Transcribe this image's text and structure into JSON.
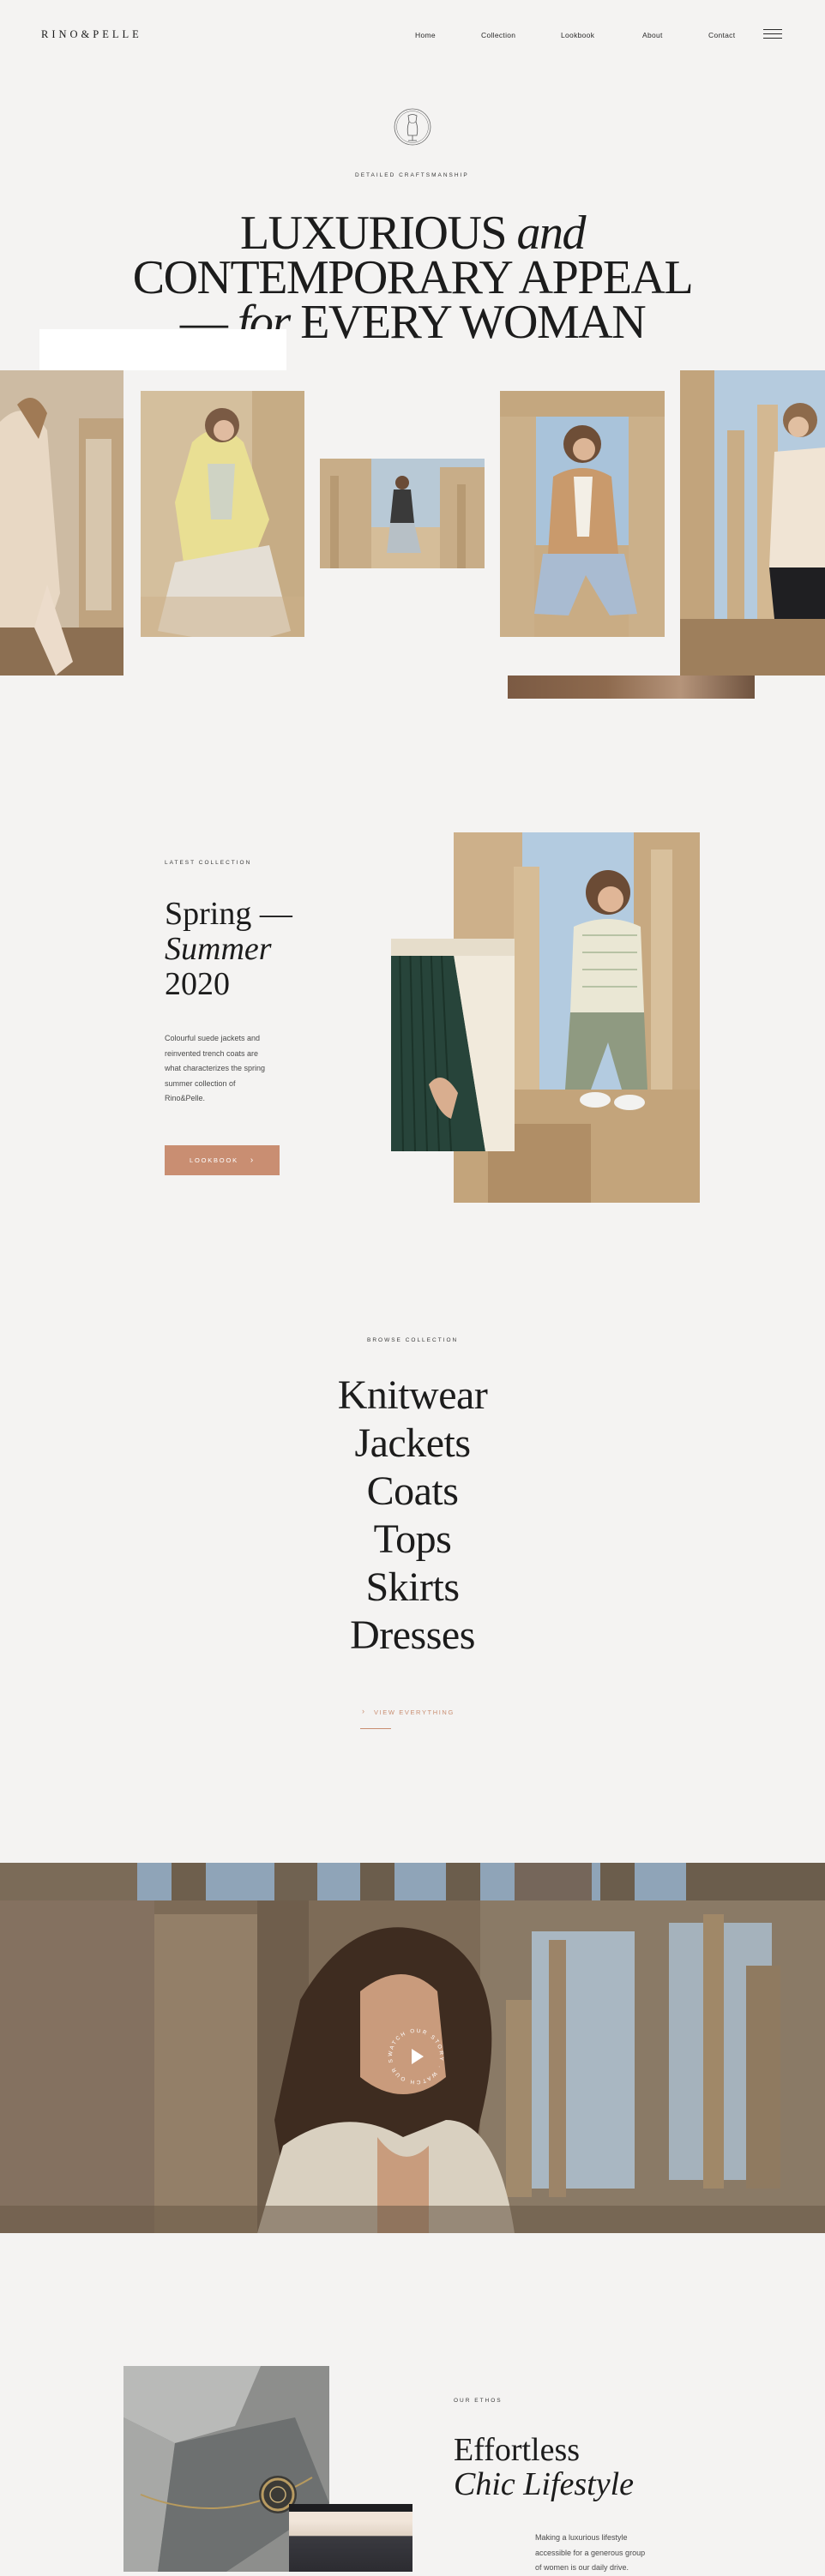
{
  "header": {
    "logo": "RINO&PELLE",
    "nav": [
      "Home",
      "Collection",
      "Lookbook",
      "About",
      "Contact"
    ],
    "menu_icon": "hamburger-icon"
  },
  "hero": {
    "emblem_icon": "dress-form-emblem-icon",
    "eyebrow": "DETAILED CRAFTSMANSHIP",
    "line1_a": "LUXURIOUS",
    "line1_b": "and",
    "line2": "CONTEMPORARY APPEAL",
    "line3_dash": "—",
    "line3_a": "for",
    "line3_b": "EVERY WOMAN"
  },
  "latest": {
    "eyebrow": "LATEST COLLECTION",
    "title_1": "Spring —",
    "title_2": "Summer",
    "title_3": "2020",
    "body_1": "Colourful suede jackets and",
    "body_2": "reinvented trench coats are",
    "body_3": "what characterizes the spring",
    "body_4": "summer collection of",
    "body_5": "Rino&Pelle.",
    "button": "LOOKBOOK",
    "button_icon": "chevron-right-icon"
  },
  "browse": {
    "eyebrow": "BROWSE COLLECTION",
    "categories": [
      "Knitwear",
      "Jackets",
      "Coats",
      "Tops",
      "Skirts",
      "Dresses"
    ],
    "view_all": "VIEW EVERYTHING",
    "view_all_icon": "chevron-right-icon"
  },
  "video": {
    "ring_text": "WATCH OUR STORY · WATCH OUR STORY ·",
    "play_icon": "play-icon"
  },
  "ethos": {
    "eyebrow": "OUR ETHOS",
    "title_1": "Effortless",
    "title_2": "Chic Lifestyle",
    "body_1": "Making a luxurious lifestyle",
    "body_2": "accessible for a generous group",
    "body_3": "of women is our daily drive."
  },
  "colors": {
    "background": "#f4f3f2",
    "accent": "#c98e72",
    "text": "#1c1c1c",
    "sand": "#cfae84"
  }
}
